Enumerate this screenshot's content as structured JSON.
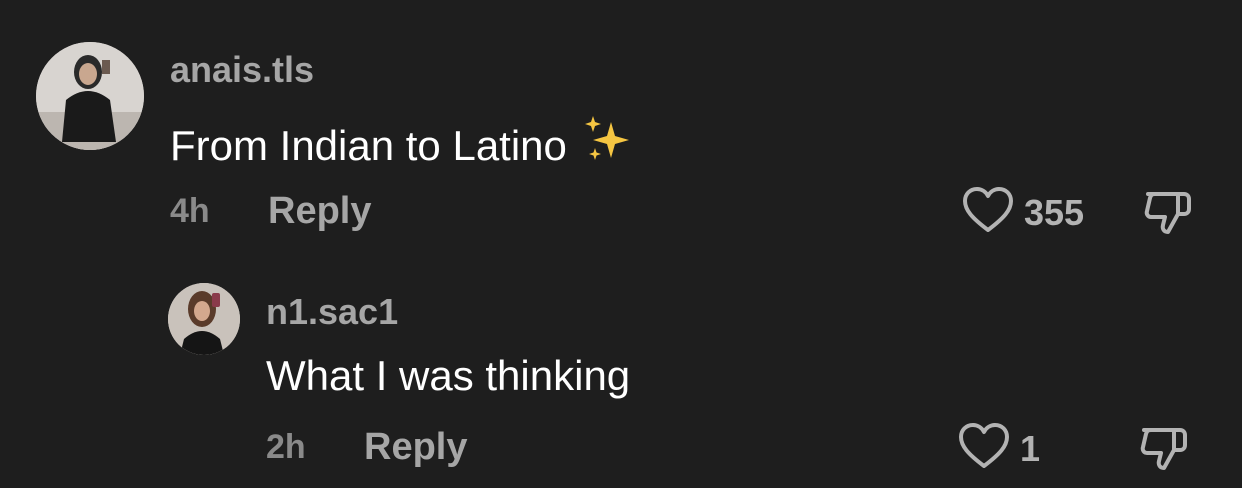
{
  "colors": {
    "background": "#1e1e1e",
    "username": "#a6a6a6",
    "text": "#ffffff",
    "meta": "#8a8a8a",
    "icon": "#b3b3b3",
    "sparkle": "#f5c542"
  },
  "comments": [
    {
      "username": "anais.tls",
      "text": "From Indian to Latino",
      "emoji": "sparkles-emoji",
      "time": "4h",
      "reply_label": "Reply",
      "likes": "355"
    },
    {
      "username": "n1.sac1",
      "text": "What I was thinking",
      "time": "2h",
      "reply_label": "Reply",
      "likes": "1"
    }
  ]
}
